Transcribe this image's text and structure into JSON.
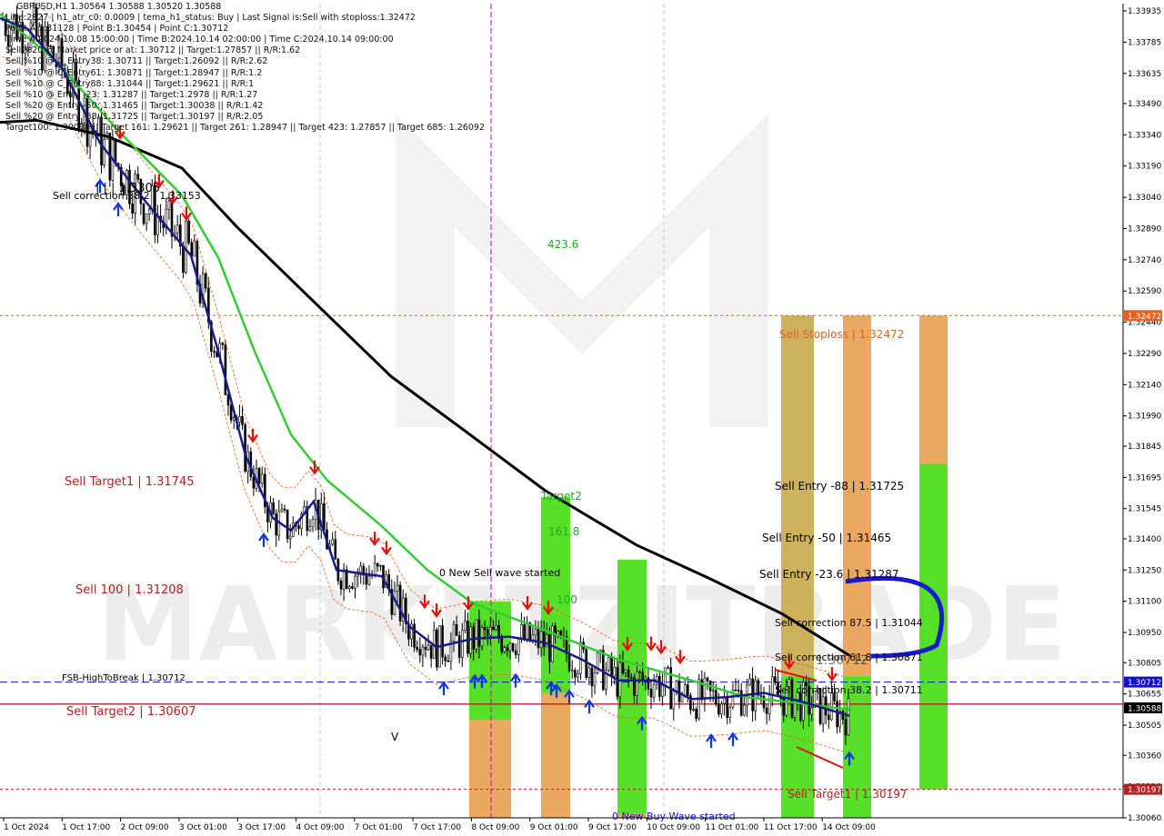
{
  "window": {
    "header": "GBPUSD,H1  1.30564 1.30588 1.30520 1.30588",
    "info_lines": [
      "Line:2827  |  h1_atr_c0: 0.0009  |  tema_h1_status: Buy  |  Last Signal is:Sell with stoploss:1.32472",
      "Point A:1.31128  |  Point B:1.30454  |  Point C:1.30712",
      "Time A:2024.10.08 15:00:00  |  Time B:2024.10.14 02:00:00  |  Time C:2024.10.14 09:00:00",
      "Sell %20 @ Market price or at: 1.30712  ||  Target:1.27857  ||  R/R:1.62",
      "Sell %10 @ C_Entry38: 1.30711  ||  Target:1.26092  ||  R/R:2.62",
      "Sell %10 @ C_Entry61: 1.30871  ||  Target:1.28947  ||  R/R:1.2",
      "Sell %10 @ C_Entry88: 1.31044  ||  Target:1.29621  ||  R/R:1",
      "Sell %10 @ Entry -23: 1.31287  ||  Target:1.2978  ||  R/R:1.27",
      "Sell %20 @ Entry -50: 1.31465  ||  Target:1.30038  ||  R/R:1.42",
      "Sell %20 @ Entry -88: 1.31725  ||  Target:1.30197  ||  R/R:2.05",
      "Target100: 1.30038  ||  Target 161: 1.29621  ||  Target 261: 1.28947  ||  Target 423: 1.27857  ||  Target 685: 1.26092"
    ]
  },
  "watermark": "MARKETZITRADE",
  "colors": {
    "bg": "#ffffff",
    "candle": "#000000",
    "ema_fast": "#1a1a8c",
    "ema_mid": "#33cc33",
    "ema_slow": "#000000",
    "sell_label": "#b22222",
    "stoploss": "#e8601c",
    "buy_arrow": "#1034e8",
    "sell_arrow": "#e01010",
    "blue_line": "#1010cc",
    "green_zone": "#44dd11",
    "orange_zone": "#e8a050",
    "olive_zone": "#c9a84a"
  },
  "chart_data": {
    "type": "candlestick",
    "symbol": "GBPUSD",
    "timeframe": "H1",
    "ylim": [
      1.3006,
      1.3397
    ],
    "y_ticks": [
      "1.33935",
      "1.33785",
      "1.33635",
      "1.33490",
      "1.33340",
      "1.33190",
      "1.33040",
      "1.32890",
      "1.32740",
      "1.32590",
      "1.32440",
      "1.32290",
      "1.32140",
      "1.31990",
      "1.31845",
      "1.31695",
      "1.31545",
      "1.31400",
      "1.31250",
      "1.31100",
      "1.30950",
      "1.30805",
      "1.30655",
      "1.30505",
      "1.30360",
      "1.30210",
      "1.30060"
    ],
    "x_ticks": [
      "1 Oct 2024",
      "1 Oct 17:00",
      "2 Oct 09:00",
      "3 Oct 01:00",
      "3 Oct 17:00",
      "4 Oct 09:00",
      "7 Oct 01:00",
      "7 Oct 17:00",
      "8 Oct 09:00",
      "9 Oct 01:00",
      "9 Oct 17:00",
      "10 Oct 09:00",
      "11 Oct 01:00",
      "11 Oct 17:00",
      "14 Oct 09:00"
    ],
    "price_tags": [
      {
        "text": "1.32472",
        "value": 1.32472,
        "color": "#e8601c"
      },
      {
        "text": "1.30712",
        "value": 1.30712,
        "color": "#1010cc"
      },
      {
        "text": "1.30588",
        "value": 1.30588,
        "color": "#000000"
      },
      {
        "text": "1.30197",
        "value": 1.30197,
        "color": "#b22222"
      }
    ],
    "levels": [
      {
        "label": "Sell Stoploss | 1.32472",
        "value": 1.32472,
        "style": "dotted",
        "color": "#e8601c"
      },
      {
        "label": "FSB-HighToBreak | 1.30712",
        "value": 1.30712,
        "style": "dashed",
        "color": "#1010cc"
      },
      {
        "label": "Sell Target2 | 1.30607",
        "value": 1.30607,
        "style": "solid",
        "color": "#b22222"
      },
      {
        "label": "Sell Target1 | 1.30197",
        "value": 1.30197,
        "style": "dotted",
        "color": "#b22222"
      }
    ],
    "annotations": [
      {
        "text": "Sell Target1 | 1.31745",
        "color": "#b22222"
      },
      {
        "text": "Sell 100 | 1.31208",
        "color": "#b22222"
      },
      {
        "text": "FSB-HighToBreak | 1.30712",
        "color": "#000000"
      },
      {
        "text": "Sell Target2 | 1.30607",
        "color": "#b22222"
      },
      {
        "text": "Sell correction 38.2 | 1.33153",
        "color": "#000000"
      },
      {
        "text": "| | | 1.3305",
        "color": "#000000"
      },
      {
        "text": "423.6",
        "color": "#22aa22"
      },
      {
        "text": "Target2",
        "color": "#22aa22"
      },
      {
        "text": "161.8",
        "color": "#22aa22"
      },
      {
        "text": "100",
        "color": "#22aa22"
      },
      {
        "text": "0 New Sell wave started",
        "color": "#000000"
      },
      {
        "text": "0 New Buy Wave started",
        "color": "#1010cc"
      },
      {
        "text": "Sell Stoploss | 1.32472",
        "color": "#e8601c"
      },
      {
        "text": "Sell Entry -88 | 1.31725",
        "color": "#000000"
      },
      {
        "text": "Sell Entry -50 | 1.31465",
        "color": "#000000"
      },
      {
        "text": "Sell Entry -23.6 | 1.31287",
        "color": "#000000"
      },
      {
        "text": "Sell correction 87.5 | 1.31044",
        "color": "#000000"
      },
      {
        "text": "Sell correction 61.8 | 1.30871",
        "color": "#000000"
      },
      {
        "text": "1.30712",
        "color": "#000000"
      },
      {
        "text": "Sell correction 38.2 | 1.30711",
        "color": "#000000"
      },
      {
        "text": "Sell Target1 | 1.30197",
        "color": "#b22222"
      },
      {
        "text": "V",
        "color": "#000000"
      }
    ],
    "ema_slow": [
      [
        0,
        1.334
      ],
      [
        40,
        1.3341
      ],
      [
        120,
        1.3333
      ],
      [
        200,
        1.3318
      ],
      [
        260,
        1.329
      ],
      [
        340,
        1.3256
      ],
      [
        430,
        1.3218
      ],
      [
        520,
        1.3189
      ],
      [
        600,
        1.3163
      ],
      [
        700,
        1.3137
      ],
      [
        780,
        1.3121
      ],
      [
        860,
        1.3104
      ],
      [
        934,
        1.3084
      ]
    ],
    "ema_mid": [
      [
        0,
        1.3392
      ],
      [
        60,
        1.337
      ],
      [
        130,
        1.3336
      ],
      [
        200,
        1.3305
      ],
      [
        240,
        1.3275
      ],
      [
        280,
        1.323
      ],
      [
        320,
        1.319
      ],
      [
        360,
        1.3168
      ],
      [
        420,
        1.3146
      ],
      [
        470,
        1.3125
      ],
      [
        520,
        1.3109
      ],
      [
        600,
        1.3096
      ],
      [
        680,
        1.3082
      ],
      [
        760,
        1.3072
      ],
      [
        820,
        1.3064
      ],
      [
        880,
        1.3061
      ],
      [
        934,
        1.3058
      ]
    ],
    "ema_fast": [
      [
        0,
        1.339
      ],
      [
        30,
        1.3385
      ],
      [
        70,
        1.3365
      ],
      [
        110,
        1.333
      ],
      [
        160,
        1.3302
      ],
      [
        210,
        1.3276
      ],
      [
        240,
        1.323
      ],
      [
        270,
        1.318
      ],
      [
        300,
        1.315
      ],
      [
        320,
        1.3144
      ],
      [
        345,
        1.3158
      ],
      [
        370,
        1.3125
      ],
      [
        420,
        1.3122
      ],
      [
        450,
        1.3098
      ],
      [
        480,
        1.3088
      ],
      [
        520,
        1.3092
      ],
      [
        560,
        1.3093
      ],
      [
        600,
        1.309
      ],
      [
        640,
        1.3082
      ],
      [
        680,
        1.3072
      ],
      [
        720,
        1.3072
      ],
      [
        760,
        1.3063
      ],
      [
        800,
        1.3064
      ],
      [
        840,
        1.3066
      ],
      [
        880,
        1.3062
      ],
      [
        934,
        1.3055
      ]
    ],
    "zones": [
      {
        "label": "zone-1",
        "x0": 516,
        "x1": 562,
        "bands": [
          [
            1.311,
            1.309,
            "#44dd11"
          ],
          [
            1.309,
            1.3053,
            "#44dd11"
          ],
          [
            1.3053,
            1.3006,
            "#e8a050"
          ]
        ]
      },
      {
        "label": "zone-2",
        "x0": 595,
        "x1": 627,
        "bands": [
          [
            1.316,
            1.3066,
            "#44dd11"
          ],
          [
            1.3066,
            1.3006,
            "#e8a050"
          ]
        ]
      },
      {
        "label": "zone-3",
        "x0": 679,
        "x1": 711,
        "bands": [
          [
            1.313,
            1.3008,
            "#44dd11"
          ],
          [
            1.3008,
            1.3006,
            "#e8a050"
          ]
        ]
      },
      {
        "label": "zone-4",
        "x0": 859,
        "x1": 895,
        "bands": [
          [
            1.32472,
            1.3074,
            "#c9a84a"
          ],
          [
            1.3074,
            1.3006,
            "#44dd11"
          ]
        ]
      },
      {
        "label": "zone-5",
        "x0": 927,
        "x1": 958,
        "bands": [
          [
            1.32472,
            1.3074,
            "#e8a050"
          ],
          [
            1.3074,
            1.3006,
            "#44dd11"
          ]
        ]
      },
      {
        "label": "zone-6",
        "x0": 1011,
        "x1": 1042,
        "bands": [
          [
            1.32472,
            1.3176,
            "#e8a050"
          ],
          [
            1.3176,
            1.30197,
            "#44dd11"
          ]
        ]
      }
    ]
  }
}
